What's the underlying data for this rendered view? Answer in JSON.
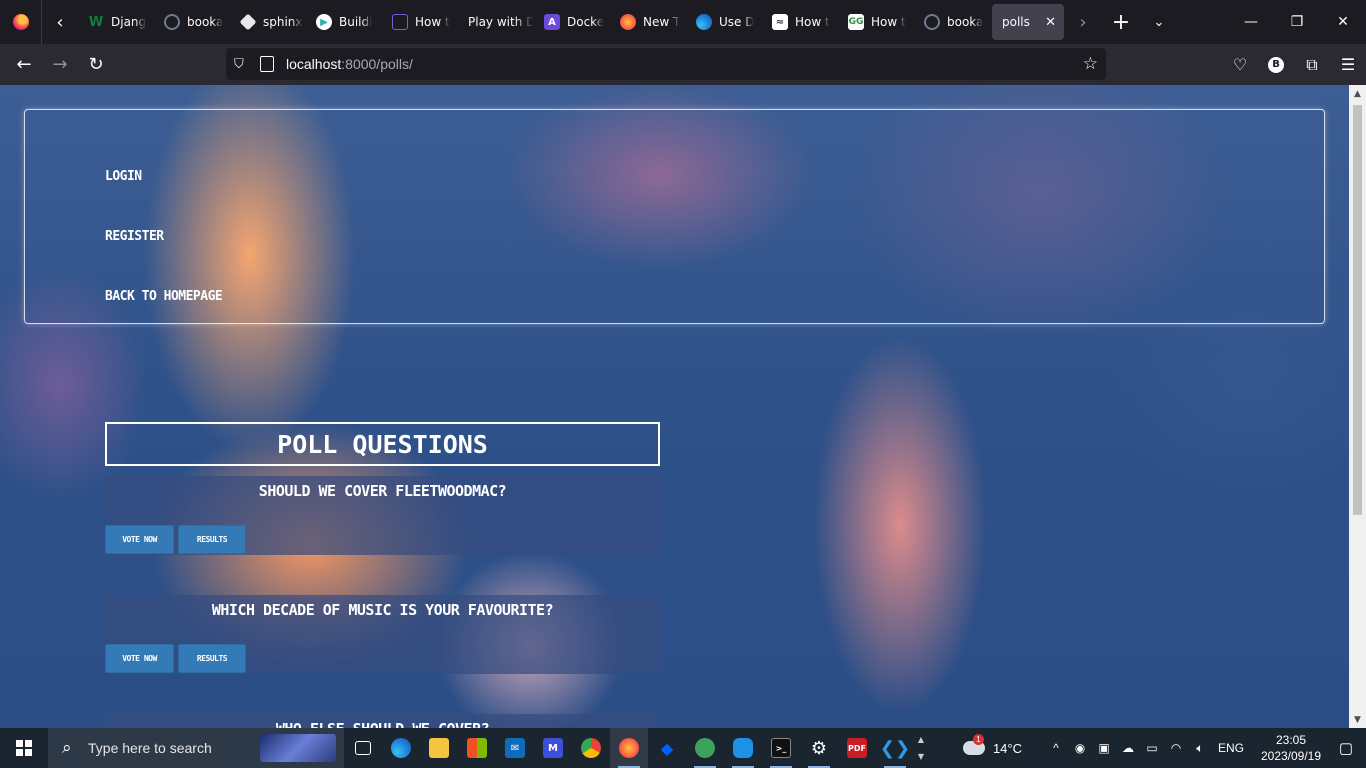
{
  "browser": {
    "tabs": [
      {
        "label": "Djang",
        "favicon": "W",
        "color": "#0b8043"
      },
      {
        "label": "booka",
        "favicon": "",
        "color": "#3b4a5e"
      },
      {
        "label": "sphinx",
        "favicon": "",
        "color": "#ffffff"
      },
      {
        "label": "Buildi",
        "favicon": "",
        "color": "#2bb3a6"
      },
      {
        "label": "How t",
        "favicon": "",
        "color": "#5b3fa0"
      },
      {
        "label": "Play with D",
        "favicon": "",
        "color": "#1c1b22"
      },
      {
        "label": "Docke",
        "favicon": "A",
        "color": "#6d4ad8"
      },
      {
        "label": "New T",
        "favicon": "",
        "color": "#ff7139"
      },
      {
        "label": "Use D",
        "favicon": "",
        "color": "#1a6fd1"
      },
      {
        "label": "How t",
        "favicon": "",
        "color": "#ffffff"
      },
      {
        "label": "How t",
        "favicon": "",
        "color": "#2f8d46"
      },
      {
        "label": "booka",
        "favicon": "",
        "color": "#3b4a5e"
      }
    ],
    "active_tab": {
      "label": "polls",
      "close": "✕"
    },
    "url_host": "localhost",
    "url_rest": ":8000/polls/",
    "profile_initial": "B"
  },
  "page": {
    "nav_links": [
      "LOGIN",
      "REGISTER",
      "BACK TO HOMEPAGE"
    ],
    "title": "POLL QUESTIONS",
    "vote_label": "VOTE NOW",
    "results_label": "RESULTS",
    "questions": [
      "SHOULD WE COVER FLEETWOODMAC?",
      "WHICH DECADE OF MUSIC IS YOUR FAVOURITE?",
      "WHO ELSE SHOULD WE COVER?"
    ]
  },
  "taskbar": {
    "search_placeholder": "Type here to search",
    "weather": "14°C",
    "weather_badge": "1",
    "language": "ENG",
    "time": "23:05",
    "date": "2023/09/19"
  }
}
